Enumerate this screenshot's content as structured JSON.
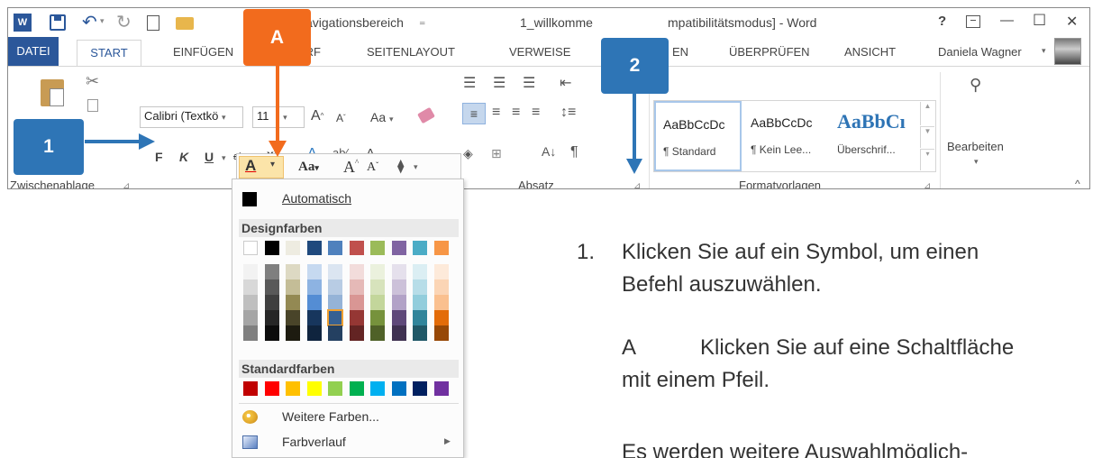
{
  "titlebar": {
    "quick_nav": "avigationsbereich",
    "doc_title": "1_willkomme",
    "compat": "mpatibilitätsmodus] - Word",
    "help": "?",
    "minimize": "—",
    "maximize": "☐",
    "close": "✕"
  },
  "tabs": [
    {
      "label": "DATEI"
    },
    {
      "label": "START"
    },
    {
      "label": "EINFÜGEN"
    },
    {
      "label": "WURF"
    },
    {
      "label": "SEITENLAYOUT"
    },
    {
      "label": "VERWEISE"
    },
    {
      "label": "EN"
    },
    {
      "label": "ÜBERPRÜFEN"
    },
    {
      "label": "ANSICHT"
    }
  ],
  "user": {
    "name": "Daniela Wagner"
  },
  "ribbon": {
    "font_name": "Calibri (Textkö",
    "font_size": "11",
    "aa_label": "Aa",
    "bold": "F",
    "italic": "K",
    "underline": "U",
    "abc": "abc",
    "superscript": "x²",
    "groups": {
      "clipboard": "Zwischenablage",
      "paragraph": "Absatz",
      "styles": "Formatvorlagen"
    },
    "styles": [
      {
        "preview": "AaBbCcDc",
        "name": "¶ Standard"
      },
      {
        "preview": "AaBbCcDc",
        "name": "¶ Kein Lee..."
      },
      {
        "preview": "AaBbCı",
        "name": "Überschrif..."
      }
    ],
    "edit_label": "Bearbeiten"
  },
  "panel": {
    "automatic": "Automatisch",
    "theme_colors_title": "Designfarben",
    "standard_colors_title": "Standardfarben",
    "more_colors": "Weitere Farben...",
    "gradient": "Farbverlauf",
    "theme_top": [
      "#ffffff",
      "#000000",
      "#eeece1",
      "#1f497d",
      "#4f81bd",
      "#c0504d",
      "#9bbb59",
      "#8064a2",
      "#4bacc6",
      "#f79646"
    ],
    "theme_shades": [
      [
        "#f2f2f2",
        "#7f7f7f",
        "#ddd9c3",
        "#c6d9f0",
        "#dbe5f1",
        "#f2dcdb",
        "#ebf1dd",
        "#e5e0ec",
        "#dbeef3",
        "#fdeada"
      ],
      [
        "#d8d8d8",
        "#595959",
        "#c4bd97",
        "#8db3e2",
        "#b8cce4",
        "#e5b9b7",
        "#d7e3bc",
        "#ccc1d9",
        "#b7dde8",
        "#fbd5b5"
      ],
      [
        "#bfbfbf",
        "#3f3f3f",
        "#938953",
        "#548dd4",
        "#95b3d7",
        "#d99694",
        "#c3d69b",
        "#b2a2c7",
        "#92cddc",
        "#fac08f"
      ],
      [
        "#a5a5a5",
        "#262626",
        "#494429",
        "#17365d",
        "#366092",
        "#953734",
        "#76923c",
        "#5f497a",
        "#31859b",
        "#e36c09"
      ],
      [
        "#7f7f7f",
        "#0c0c0c",
        "#1d1b10",
        "#0f243e",
        "#244061",
        "#632423",
        "#4f6128",
        "#3f3151",
        "#205867",
        "#974806"
      ]
    ],
    "standard": [
      "#c00000",
      "#ff0000",
      "#ffc000",
      "#ffff00",
      "#92d050",
      "#00b050",
      "#00b0f0",
      "#0070c0",
      "#002060",
      "#7030a0"
    ]
  },
  "callouts": {
    "a": "A",
    "one": "1",
    "two": "2",
    "orange": "#f26b1d",
    "blue": "#2e75b6"
  },
  "instructions": {
    "step1_num": "1.",
    "step1_line1": "Klicken Sie auf ein Symbol, um einen",
    "step1_line2": "Befehl auszuwählen.",
    "stepA_letter": "A",
    "stepA_line1": "Klicken Sie auf eine Schaltfläche",
    "stepA_line2": "mit einem Pfeil.",
    "more": "Es werden weitere Auswahlmöglich-"
  }
}
